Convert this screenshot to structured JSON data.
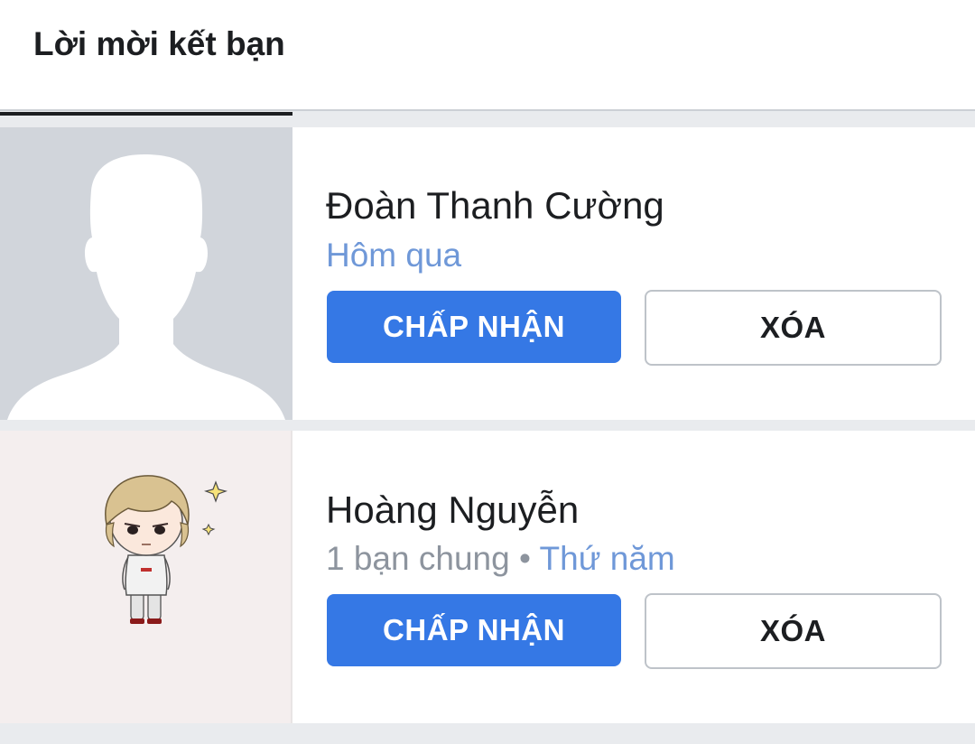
{
  "header": {
    "title": "Lời mời kết bạn"
  },
  "colors": {
    "accent": "#3578e5",
    "time_link": "#6f98d8",
    "muted_text": "#8d949e",
    "background": "#e9ebee"
  },
  "requests": [
    {
      "avatar": "default-silhouette-icon",
      "name": "Đoàn Thanh Cường",
      "mutual": "",
      "separator": "",
      "time": "Hôm qua",
      "accept_label": "CHẤP NHẬN",
      "delete_label": "XÓA"
    },
    {
      "avatar": "chibi-character-avatar",
      "name": "Hoàng Nguyễn",
      "mutual": "1 bạn chung",
      "separator": " • ",
      "time": "Thứ năm",
      "accept_label": "CHẤP NHẬN",
      "delete_label": "XÓA"
    }
  ]
}
